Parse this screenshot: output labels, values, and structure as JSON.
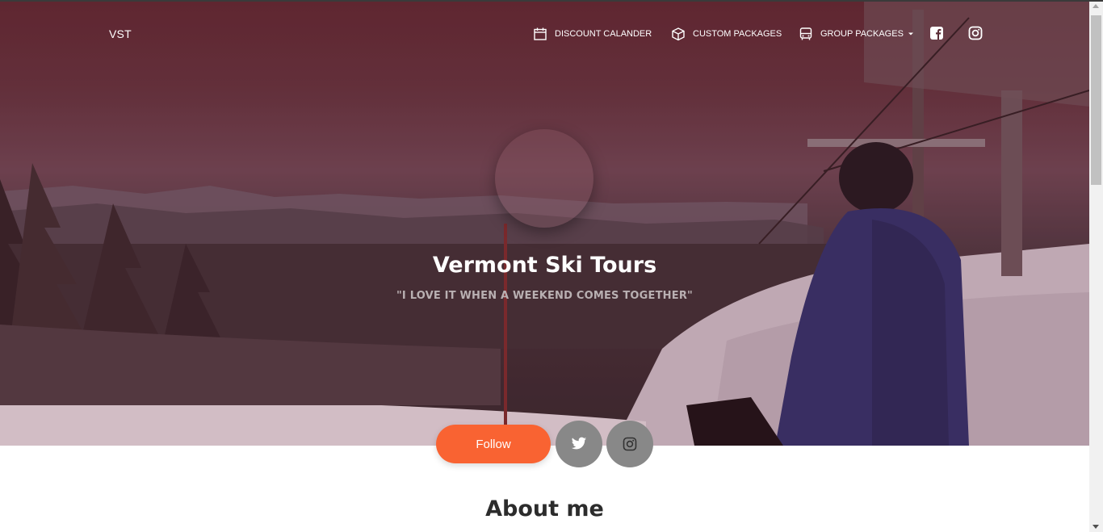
{
  "nav": {
    "brand": "VST",
    "items": [
      {
        "label": "DISCOUNT CALANDER",
        "icon": "calendar-icon"
      },
      {
        "label": "CUSTOM PACKAGES",
        "icon": "box-icon"
      },
      {
        "label": "GROUP PACKAGES",
        "icon": "bus-icon",
        "has_dropdown": true
      }
    ],
    "social": [
      "facebook-icon",
      "instagram-icon"
    ]
  },
  "hero": {
    "title": "Vermont Ski Tours",
    "subtitle": "\"I LOVE IT WHEN A WEEKEND COMES TOGETHER\""
  },
  "actions": {
    "follow_label": "Follow",
    "buttons": [
      "twitter-icon",
      "instagram-icon"
    ]
  },
  "about": {
    "heading": "About me"
  },
  "colors": {
    "accent": "#f96332",
    "round_button": "#888888"
  }
}
